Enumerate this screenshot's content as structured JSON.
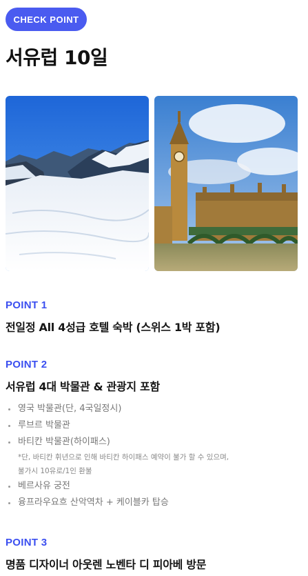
{
  "badge": {
    "label": "CHECK POINT"
  },
  "title": "서유럽 10일",
  "images": [
    {
      "icon": "alps-glacier-photo"
    },
    {
      "icon": "big-ben-westminster-photo"
    }
  ],
  "points": [
    {
      "label": "POINT 1",
      "title": "전일정 All 4성급 호텔 숙박 (스위스 1박 포함)"
    },
    {
      "label": "POINT 2",
      "title": "서유럽 4대 박물관 & 관광지 포함",
      "items": [
        {
          "text": "영국 박물관(단, 4국일정시)"
        },
        {
          "text": "루브르 박물관"
        },
        {
          "text": "바티칸 박물관(하이패스)",
          "note_1": "*단, 바티칸 휘년으로 인해 바티칸 하이패스 예약이 불가 할 수 있으며,",
          "note_2": "불가시 10유로/1인 환불"
        },
        {
          "text": "베르사유 궁전"
        },
        {
          "text": "융프라우요흐 산악역차 + 케이블카 탑승"
        }
      ]
    },
    {
      "label": "POINT 3",
      "title": "명품 디자이너 아웃렌 노벤타 디 피아베 방문"
    }
  ],
  "colors": {
    "accent": "#4a5bf0",
    "point_label": "#3b4ff0"
  }
}
